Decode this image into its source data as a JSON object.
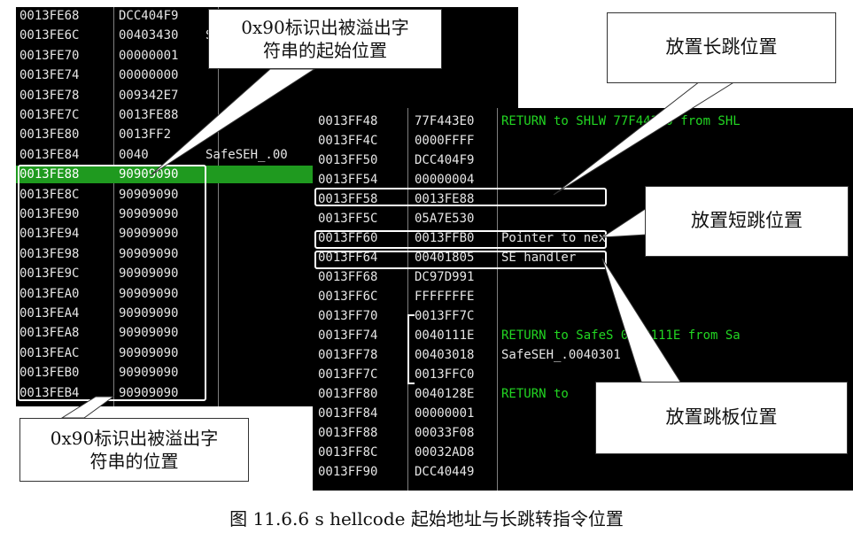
{
  "left_stack": {
    "rows": [
      {
        "addr": "0013FE68",
        "val": "DCC404F9",
        "cmt": ""
      },
      {
        "addr": "0013FE6C",
        "val": "00403430",
        "cmt": "S"
      },
      {
        "addr": "0013FE70",
        "val": "00000001",
        "cmt": ""
      },
      {
        "addr": "0013FE74",
        "val": "00000000",
        "cmt": ""
      },
      {
        "addr": "0013FE78",
        "val": "009342E7",
        "cmt": ""
      },
      {
        "addr": "0013FE7C",
        "val": "0013FE88",
        "cmt": ""
      },
      {
        "addr": "0013FE80",
        "val": "0013FF2",
        "cmt": ""
      },
      {
        "addr": "0013FE84",
        "val": "0040",
        "cmt": "SafeSEH_.00"
      },
      {
        "addr": "0013FE88",
        "val": "90909090",
        "cmt": ""
      },
      {
        "addr": "0013FE8C",
        "val": "90909090",
        "cmt": ""
      },
      {
        "addr": "0013FE90",
        "val": "90909090",
        "cmt": ""
      },
      {
        "addr": "0013FE94",
        "val": "90909090",
        "cmt": ""
      },
      {
        "addr": "0013FE98",
        "val": "90909090",
        "cmt": ""
      },
      {
        "addr": "0013FE9C",
        "val": "90909090",
        "cmt": ""
      },
      {
        "addr": "0013FEA0",
        "val": "90909090",
        "cmt": ""
      },
      {
        "addr": "0013FEA4",
        "val": "90909090",
        "cmt": ""
      },
      {
        "addr": "0013FEA8",
        "val": "90909090",
        "cmt": ""
      },
      {
        "addr": "0013FEAC",
        "val": "90909090",
        "cmt": ""
      },
      {
        "addr": "0013FEB0",
        "val": "90909090",
        "cmt": ""
      },
      {
        "addr": "0013FEB4",
        "val": "90909090",
        "cmt": ""
      }
    ]
  },
  "right_stack": {
    "rows": [
      {
        "addr": "0013FF48",
        "val": "77F443E0",
        "cmt": "RETURN to SHLW    77F443E0 from SHL",
        "green": true
      },
      {
        "addr": "0013FF4C",
        "val": "0000FFFF",
        "cmt": "",
        "green": false
      },
      {
        "addr": "0013FF50",
        "val": "DCC404F9",
        "cmt": "",
        "green": false
      },
      {
        "addr": "0013FF54",
        "val": "00000004",
        "cmt": "",
        "green": false
      },
      {
        "addr": "0013FF58",
        "val": "0013FE88",
        "cmt": "",
        "green": false
      },
      {
        "addr": "0013FF5C",
        "val": "05A7E530",
        "cmt": "",
        "green": false
      },
      {
        "addr": "0013FF60",
        "val": "0013FFB0",
        "cmt": "Pointer to nex",
        "green": false
      },
      {
        "addr": "0013FF64",
        "val": "00401805",
        "cmt": "SE handler",
        "green": false
      },
      {
        "addr": "0013FF68",
        "val": "DC97D991",
        "cmt": "",
        "green": false
      },
      {
        "addr": "0013FF6C",
        "val": "FFFFFFFE",
        "cmt": "",
        "green": false
      },
      {
        "addr": "0013FF70",
        "val": "0013FF7C",
        "cmt": "",
        "green": false
      },
      {
        "addr": "0013FF74",
        "val": "0040111E",
        "cmt": "RETURN to SafeS    0040111E from Sa",
        "green": true
      },
      {
        "addr": "0013FF78",
        "val": "00403018",
        "cmt": "SafeSEH_.0040301",
        "green": false
      },
      {
        "addr": "0013FF7C",
        "val": "0013FFC0",
        "cmt": "",
        "green": false
      },
      {
        "addr": "0013FF80",
        "val": "0040128E",
        "cmt": "RETURN to",
        "green": true
      },
      {
        "addr": "0013FF84",
        "val": "00000001",
        "cmt": "",
        "green": false
      },
      {
        "addr": "0013FF88",
        "val": "00033F08",
        "cmt": "",
        "green": false
      },
      {
        "addr": "0013FF8C",
        "val": "00032AD8",
        "cmt": "",
        "green": false
      },
      {
        "addr": "0013FF90",
        "val": "DCC40449",
        "cmt": "",
        "green": false
      }
    ]
  },
  "callouts": {
    "shellcode_start": "0x90标识出被溢出字\n符串的起始位置",
    "shellcode_pos": "0x90标识出被溢出字\n符串的位置",
    "long_jump": "放置长跳位置",
    "short_jump": "放置短跳位置",
    "trampoline": "放置跳板位置"
  },
  "caption": "图 11.6.6  s  hellcode 起始地址与长跳转指令位置",
  "colors": {
    "panel_bg": "#000000",
    "highlight": "#1f9a1f",
    "green_text": "#22d622",
    "text": "#e6e6e6"
  }
}
